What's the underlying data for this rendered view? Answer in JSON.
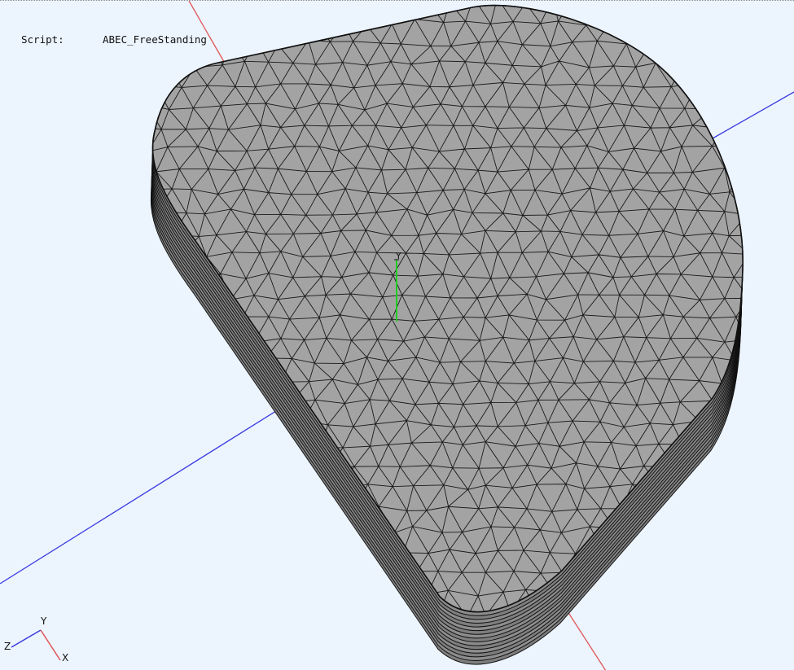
{
  "viewport": {
    "script_label": "Script:",
    "script_name": "ABEC_FreeStanding",
    "origin_label": "Y",
    "triad": {
      "y_label": "Y",
      "z_label": "Z",
      "x_label": "X"
    },
    "colors": {
      "background": "#ecf4fe",
      "mesh_fill": "#a3a3a3",
      "mesh_edge": "#1a1a1a",
      "axis_x": "#e05555",
      "axis_z": "#3a3ae0",
      "axis_y": "#22cc22"
    },
    "model": {
      "type": "triangulated-mesh",
      "shape": "rounded-triangular-baffle"
    }
  }
}
